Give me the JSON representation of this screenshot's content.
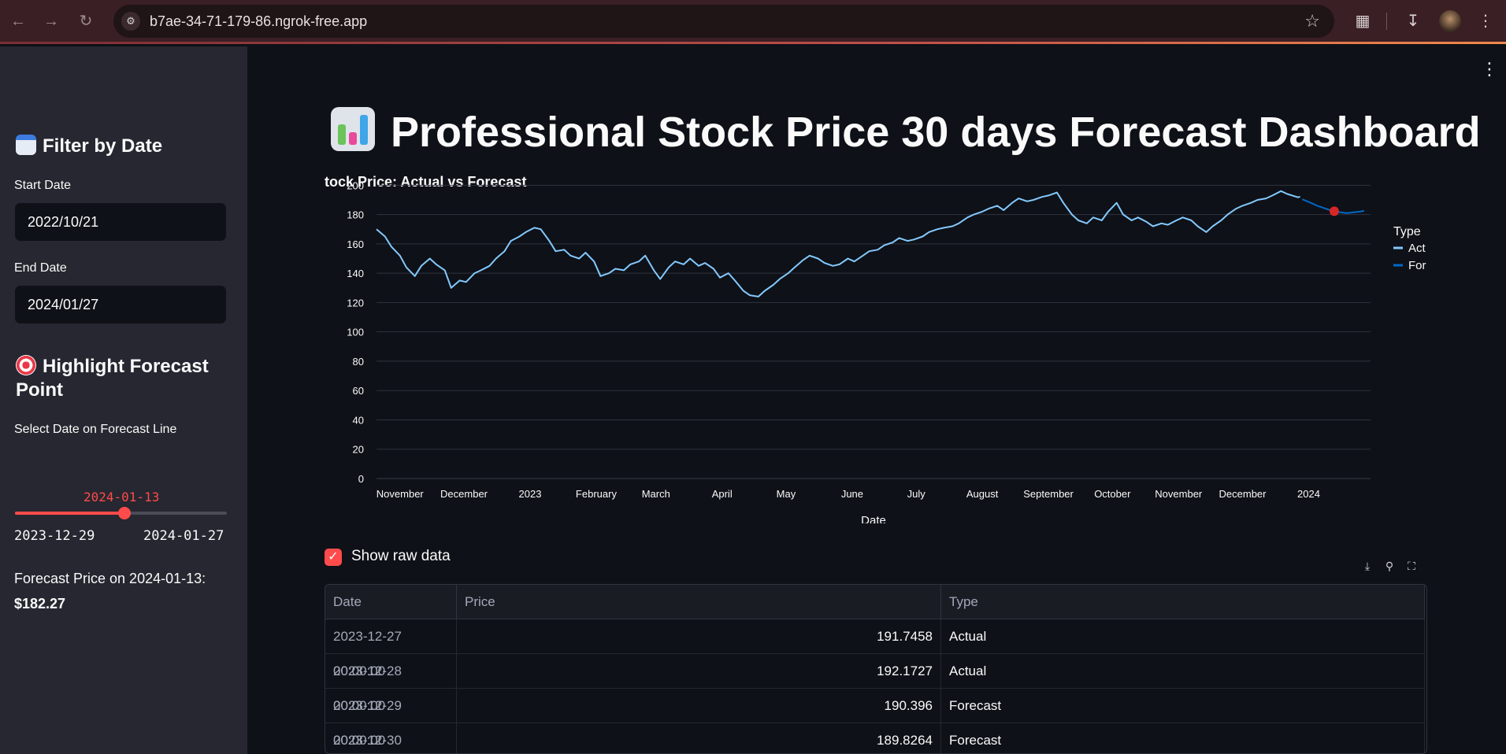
{
  "browser": {
    "url": "b7ae-34-71-179-86.ngrok-free.app"
  },
  "sidebar": {
    "filter_title": "Filter by Date",
    "start_label": "Start Date",
    "start_value": "2022/10/21",
    "end_label": "End Date",
    "end_value": "2024/01/27",
    "highlight_title": "Highlight Forecast Point",
    "slider_label": "Select Date on Forecast Line",
    "slider_value": "2024-01-13",
    "slider_min": "2023-12-29",
    "slider_max": "2024-01-27",
    "forecast_text": "Forecast Price on 2024-01-13:",
    "forecast_price": "$182.27"
  },
  "main": {
    "title": "Professional Stock Price 30 days Forecast Dashboard",
    "show_raw_label": "Show raw data",
    "table": {
      "columns": [
        "Date",
        "Price",
        "Type"
      ],
      "rows": [
        {
          "date": "2023-12-27 00:00:00",
          "price": "191.7458",
          "type": "Actual"
        },
        {
          "date": "2023-12-28 00:00:00",
          "price": "192.1727",
          "type": "Actual"
        },
        {
          "date": "2023-12-29 00:00:00",
          "price": "190.396",
          "type": "Forecast"
        },
        {
          "date": "2023-12-30 00:00:00",
          "price": "189.8264",
          "type": "Forecast"
        }
      ]
    }
  },
  "chart_data": {
    "type": "line",
    "title": "tock Price: Actual vs Forecast",
    "xlabel": "Date",
    "ylabel": "",
    "ylim": [
      0,
      205
    ],
    "yticks": [
      0,
      20,
      40,
      60,
      80,
      100,
      120,
      140,
      160,
      180,
      200
    ],
    "xticks": [
      {
        "label": "November",
        "date": "2022-11-01"
      },
      {
        "label": "December",
        "date": "2022-12-01"
      },
      {
        "label": "2023",
        "date": "2023-01-01"
      },
      {
        "label": "February",
        "date": "2023-02-01"
      },
      {
        "label": "March",
        "date": "2023-03-01"
      },
      {
        "label": "April",
        "date": "2023-04-01"
      },
      {
        "label": "May",
        "date": "2023-05-01"
      },
      {
        "label": "June",
        "date": "2023-06-01"
      },
      {
        "label": "July",
        "date": "2023-07-01"
      },
      {
        "label": "August",
        "date": "2023-08-01"
      },
      {
        "label": "September",
        "date": "2023-09-01"
      },
      {
        "label": "October",
        "date": "2023-10-01"
      },
      {
        "label": "November",
        "date": "2023-11-01"
      },
      {
        "label": "December",
        "date": "2023-12-01"
      },
      {
        "label": "2024",
        "date": "2024-01-01"
      }
    ],
    "legend_title": "Type",
    "legend_position": "right",
    "series": [
      {
        "name": "Act",
        "color": "#83c9ff",
        "points": [
          [
            "2022-10-21",
            170
          ],
          [
            "2022-10-25",
            165
          ],
          [
            "2022-10-28",
            158
          ],
          [
            "2022-11-01",
            152
          ],
          [
            "2022-11-04",
            144
          ],
          [
            "2022-11-08",
            138
          ],
          [
            "2022-11-11",
            145
          ],
          [
            "2022-11-15",
            150
          ],
          [
            "2022-11-18",
            146
          ],
          [
            "2022-11-22",
            142
          ],
          [
            "2022-11-25",
            130
          ],
          [
            "2022-11-29",
            135
          ],
          [
            "2022-12-02",
            134
          ],
          [
            "2022-12-06",
            140
          ],
          [
            "2022-12-09",
            142
          ],
          [
            "2022-12-13",
            145
          ],
          [
            "2022-12-16",
            150
          ],
          [
            "2022-12-20",
            155
          ],
          [
            "2022-12-23",
            162
          ],
          [
            "2022-12-27",
            165
          ],
          [
            "2022-12-30",
            168
          ],
          [
            "2023-01-03",
            171
          ],
          [
            "2023-01-06",
            170
          ],
          [
            "2023-01-10",
            162
          ],
          [
            "2023-01-13",
            155
          ],
          [
            "2023-01-17",
            156
          ],
          [
            "2023-01-20",
            152
          ],
          [
            "2023-01-24",
            150
          ],
          [
            "2023-01-27",
            154
          ],
          [
            "2023-01-31",
            148
          ],
          [
            "2023-02-03",
            138
          ],
          [
            "2023-02-07",
            140
          ],
          [
            "2023-02-10",
            143
          ],
          [
            "2023-02-14",
            142
          ],
          [
            "2023-02-17",
            146
          ],
          [
            "2023-02-21",
            148
          ],
          [
            "2023-02-24",
            152
          ],
          [
            "2023-02-28",
            142
          ],
          [
            "2023-03-03",
            136
          ],
          [
            "2023-03-07",
            144
          ],
          [
            "2023-03-10",
            148
          ],
          [
            "2023-03-14",
            146
          ],
          [
            "2023-03-17",
            150
          ],
          [
            "2023-03-21",
            145
          ],
          [
            "2023-03-24",
            147
          ],
          [
            "2023-03-28",
            143
          ],
          [
            "2023-03-31",
            137
          ],
          [
            "2023-04-04",
            140
          ],
          [
            "2023-04-07",
            135
          ],
          [
            "2023-04-11",
            128
          ],
          [
            "2023-04-14",
            125
          ],
          [
            "2023-04-18",
            124
          ],
          [
            "2023-04-21",
            128
          ],
          [
            "2023-04-25",
            132
          ],
          [
            "2023-04-28",
            136
          ],
          [
            "2023-05-02",
            140
          ],
          [
            "2023-05-05",
            144
          ],
          [
            "2023-05-09",
            149
          ],
          [
            "2023-05-12",
            152
          ],
          [
            "2023-05-16",
            150
          ],
          [
            "2023-05-19",
            147
          ],
          [
            "2023-05-23",
            145
          ],
          [
            "2023-05-26",
            146
          ],
          [
            "2023-05-30",
            150
          ],
          [
            "2023-06-02",
            148
          ],
          [
            "2023-06-06",
            152
          ],
          [
            "2023-06-09",
            155
          ],
          [
            "2023-06-13",
            156
          ],
          [
            "2023-06-16",
            159
          ],
          [
            "2023-06-20",
            161
          ],
          [
            "2023-06-23",
            164
          ],
          [
            "2023-06-27",
            162
          ],
          [
            "2023-06-30",
            163
          ],
          [
            "2023-07-04",
            165
          ],
          [
            "2023-07-07",
            168
          ],
          [
            "2023-07-11",
            170
          ],
          [
            "2023-07-14",
            171
          ],
          [
            "2023-07-18",
            172
          ],
          [
            "2023-07-21",
            174
          ],
          [
            "2023-07-25",
            178
          ],
          [
            "2023-07-28",
            180
          ],
          [
            "2023-08-01",
            182
          ],
          [
            "2023-08-04",
            184
          ],
          [
            "2023-08-08",
            186
          ],
          [
            "2023-08-11",
            183
          ],
          [
            "2023-08-15",
            188
          ],
          [
            "2023-08-18",
            191
          ],
          [
            "2023-08-22",
            189
          ],
          [
            "2023-08-25",
            190
          ],
          [
            "2023-08-29",
            192
          ],
          [
            "2023-09-01",
            193
          ],
          [
            "2023-09-05",
            195
          ],
          [
            "2023-09-08",
            188
          ],
          [
            "2023-09-12",
            180
          ],
          [
            "2023-09-15",
            176
          ],
          [
            "2023-09-19",
            174
          ],
          [
            "2023-09-22",
            178
          ],
          [
            "2023-09-26",
            176
          ],
          [
            "2023-09-29",
            182
          ],
          [
            "2023-10-03",
            188
          ],
          [
            "2023-10-06",
            180
          ],
          [
            "2023-10-10",
            176
          ],
          [
            "2023-10-13",
            178
          ],
          [
            "2023-10-17",
            175
          ],
          [
            "2023-10-20",
            172
          ],
          [
            "2023-10-24",
            174
          ],
          [
            "2023-10-27",
            173
          ],
          [
            "2023-10-31",
            176
          ],
          [
            "2023-11-03",
            178
          ],
          [
            "2023-11-07",
            176
          ],
          [
            "2023-11-10",
            172
          ],
          [
            "2023-11-14",
            168
          ],
          [
            "2023-11-17",
            172
          ],
          [
            "2023-11-21",
            176
          ],
          [
            "2023-11-24",
            180
          ],
          [
            "2023-11-28",
            184
          ],
          [
            "2023-12-01",
            186
          ],
          [
            "2023-12-05",
            188
          ],
          [
            "2023-12-08",
            190
          ],
          [
            "2023-12-12",
            191
          ],
          [
            "2023-12-15",
            193
          ],
          [
            "2023-12-19",
            196
          ],
          [
            "2023-12-22",
            194
          ],
          [
            "2023-12-27",
            191.7458
          ],
          [
            "2023-12-28",
            192.1727
          ]
        ]
      },
      {
        "name": "For",
        "color": "#0068c9",
        "points": [
          [
            "2023-12-29",
            190.396
          ],
          [
            "2023-12-30",
            189.8264
          ],
          [
            "2024-01-02",
            188
          ],
          [
            "2024-01-05",
            186
          ],
          [
            "2024-01-08",
            184.5
          ],
          [
            "2024-01-11",
            183
          ],
          [
            "2024-01-13",
            182.27
          ],
          [
            "2024-01-16",
            181.5
          ],
          [
            "2024-01-19",
            181
          ],
          [
            "2024-01-22",
            181.5
          ],
          [
            "2024-01-25",
            182
          ],
          [
            "2024-01-27",
            182.5
          ]
        ]
      }
    ],
    "highlight": {
      "date": "2024-01-13",
      "value": 182.27,
      "color": "#d62728"
    }
  }
}
